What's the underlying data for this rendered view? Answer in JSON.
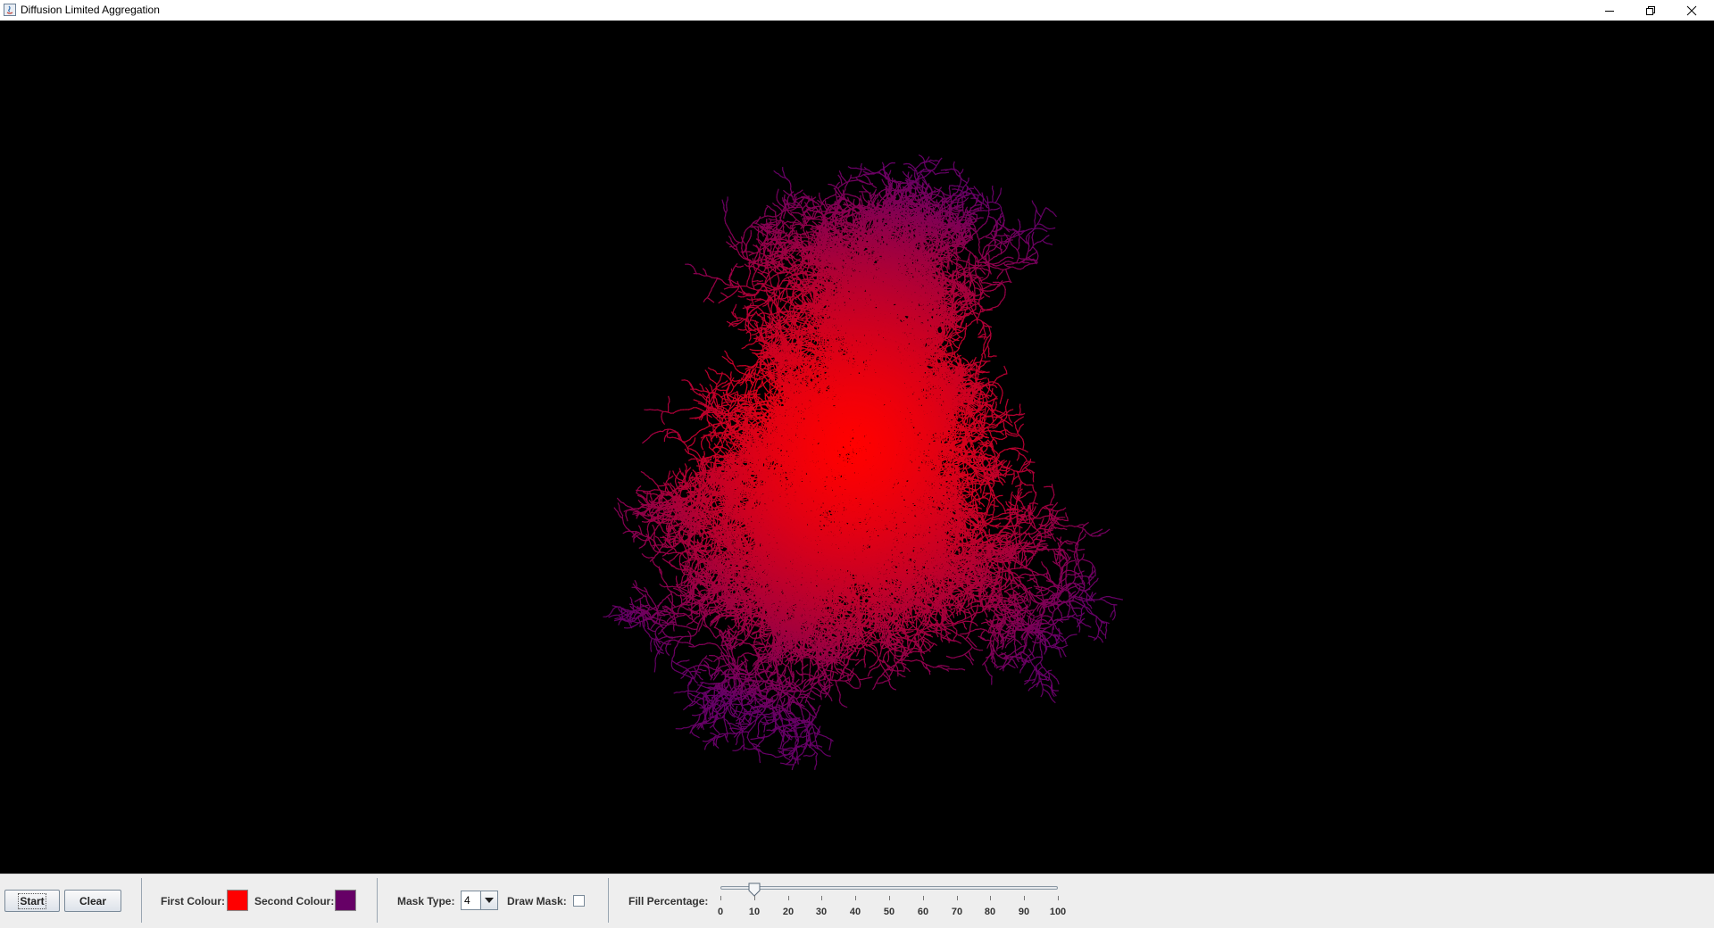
{
  "window": {
    "title": "Diffusion Limited Aggregation",
    "controls": [
      "minimize-icon",
      "restore-icon",
      "close-icon"
    ]
  },
  "toolbar": {
    "start_label": "Start",
    "clear_label": "Clear",
    "first_colour_label": "First Colour:",
    "first_colour": "#ff0000",
    "second_colour_label": "Second Colour:",
    "second_colour": "#660066",
    "mask_type_label": "Mask Type:",
    "mask_type_value": "4",
    "draw_mask_label": "Draw Mask:",
    "draw_mask_checked": false,
    "fill_percentage_label": "Fill Percentage:",
    "fill_percentage_value": 10,
    "slider_min": 0,
    "slider_max": 100,
    "slider_ticks": [
      "0",
      "10",
      "20",
      "30",
      "40",
      "50",
      "60",
      "70",
      "80",
      "90",
      "100"
    ]
  }
}
